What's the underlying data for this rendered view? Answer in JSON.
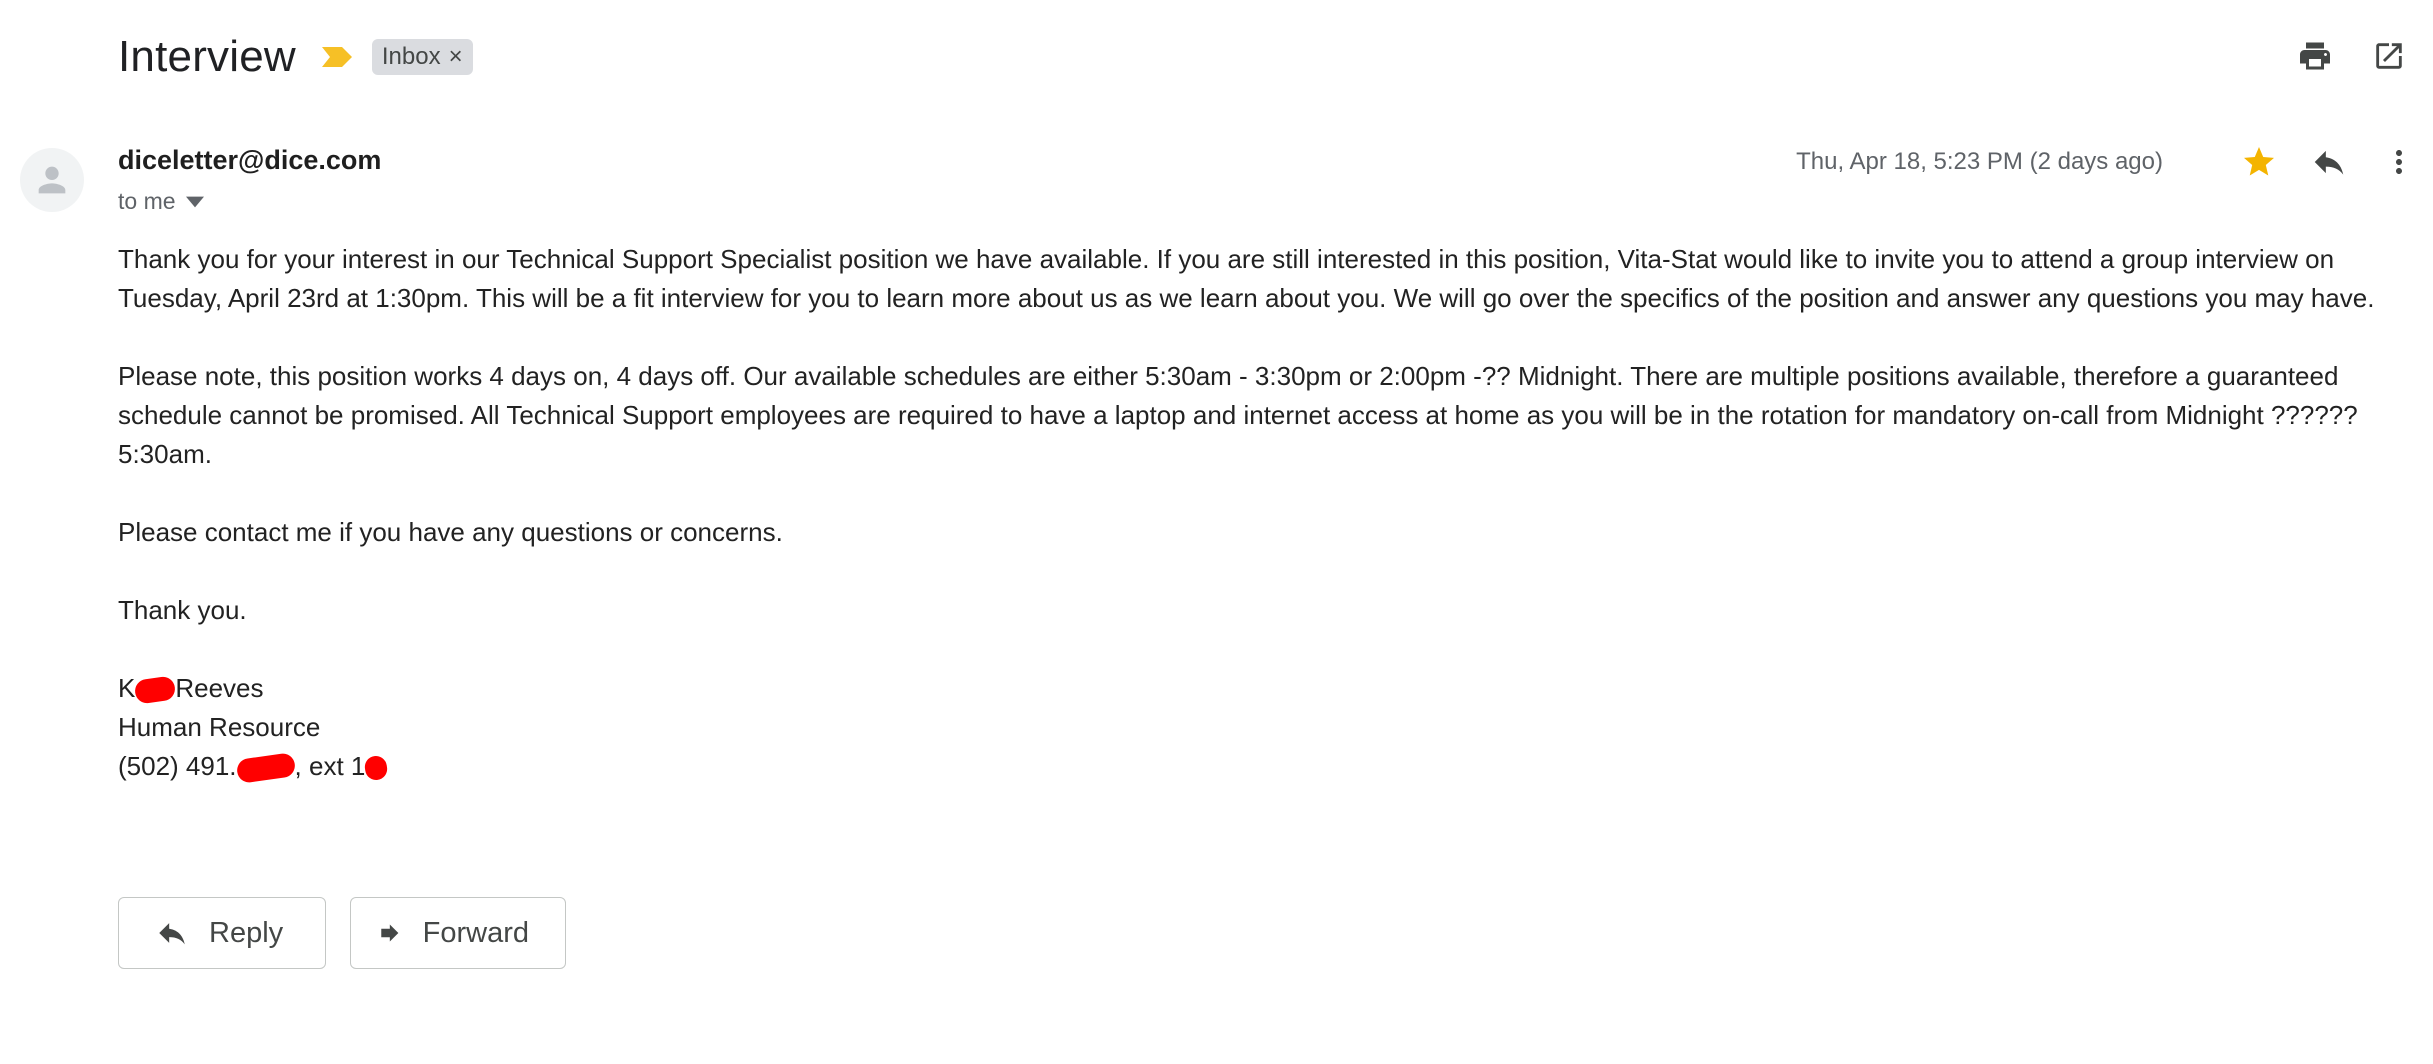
{
  "subject": "Interview",
  "label_chip": "Inbox",
  "chip_close": "×",
  "sender": "diceletter@dice.com",
  "recipient": "to me",
  "date": "Thu, Apr 18, 5:23 PM (2 days ago)",
  "body": {
    "p1": "Thank you for your interest in our Technical Support Specialist position we have available. If you are still interested in this position, Vita-Stat would like to invite you to attend a group interview on Tuesday, April 23rd at 1:30pm. This will be a fit interview for you to learn more about us as we learn about you. We will go over the specifics of the position and answer any questions you may have.",
    "p2": "Please note, this position works 4 days on, 4 days off. Our available schedules are either 5:30am - 3:30pm or 2:00pm -?? Midnight. There are multiple positions available, therefore a guaranteed schedule cannot be promised. All Technical Support employees are required to have a laptop and internet access at home as you will be in the rotation for mandatory on-call from Midnight ?????? 5:30am.",
    "p3": "Please contact me if you have any questions or concerns.",
    "p4": "Thank you."
  },
  "signature": {
    "name_start": "K",
    "name_end": "Reeves",
    "title": "Human Resource",
    "phone_start": "(502) 491.",
    "phone_mid": ", ext 1"
  },
  "buttons": {
    "reply": "Reply",
    "forward": "Forward"
  },
  "icons": {
    "importance": "importance-marker-icon",
    "print": "print-icon",
    "open_new_window": "open-in-new-window-icon",
    "avatar": "person-icon",
    "dropdown": "caret-down-icon",
    "star": "star-icon",
    "reply": "reply-icon",
    "more": "more-vert-icon",
    "forward": "forward-icon"
  },
  "colors": {
    "star": "#f4b400",
    "importance": "#f6c026",
    "redaction": "#ff0000"
  }
}
